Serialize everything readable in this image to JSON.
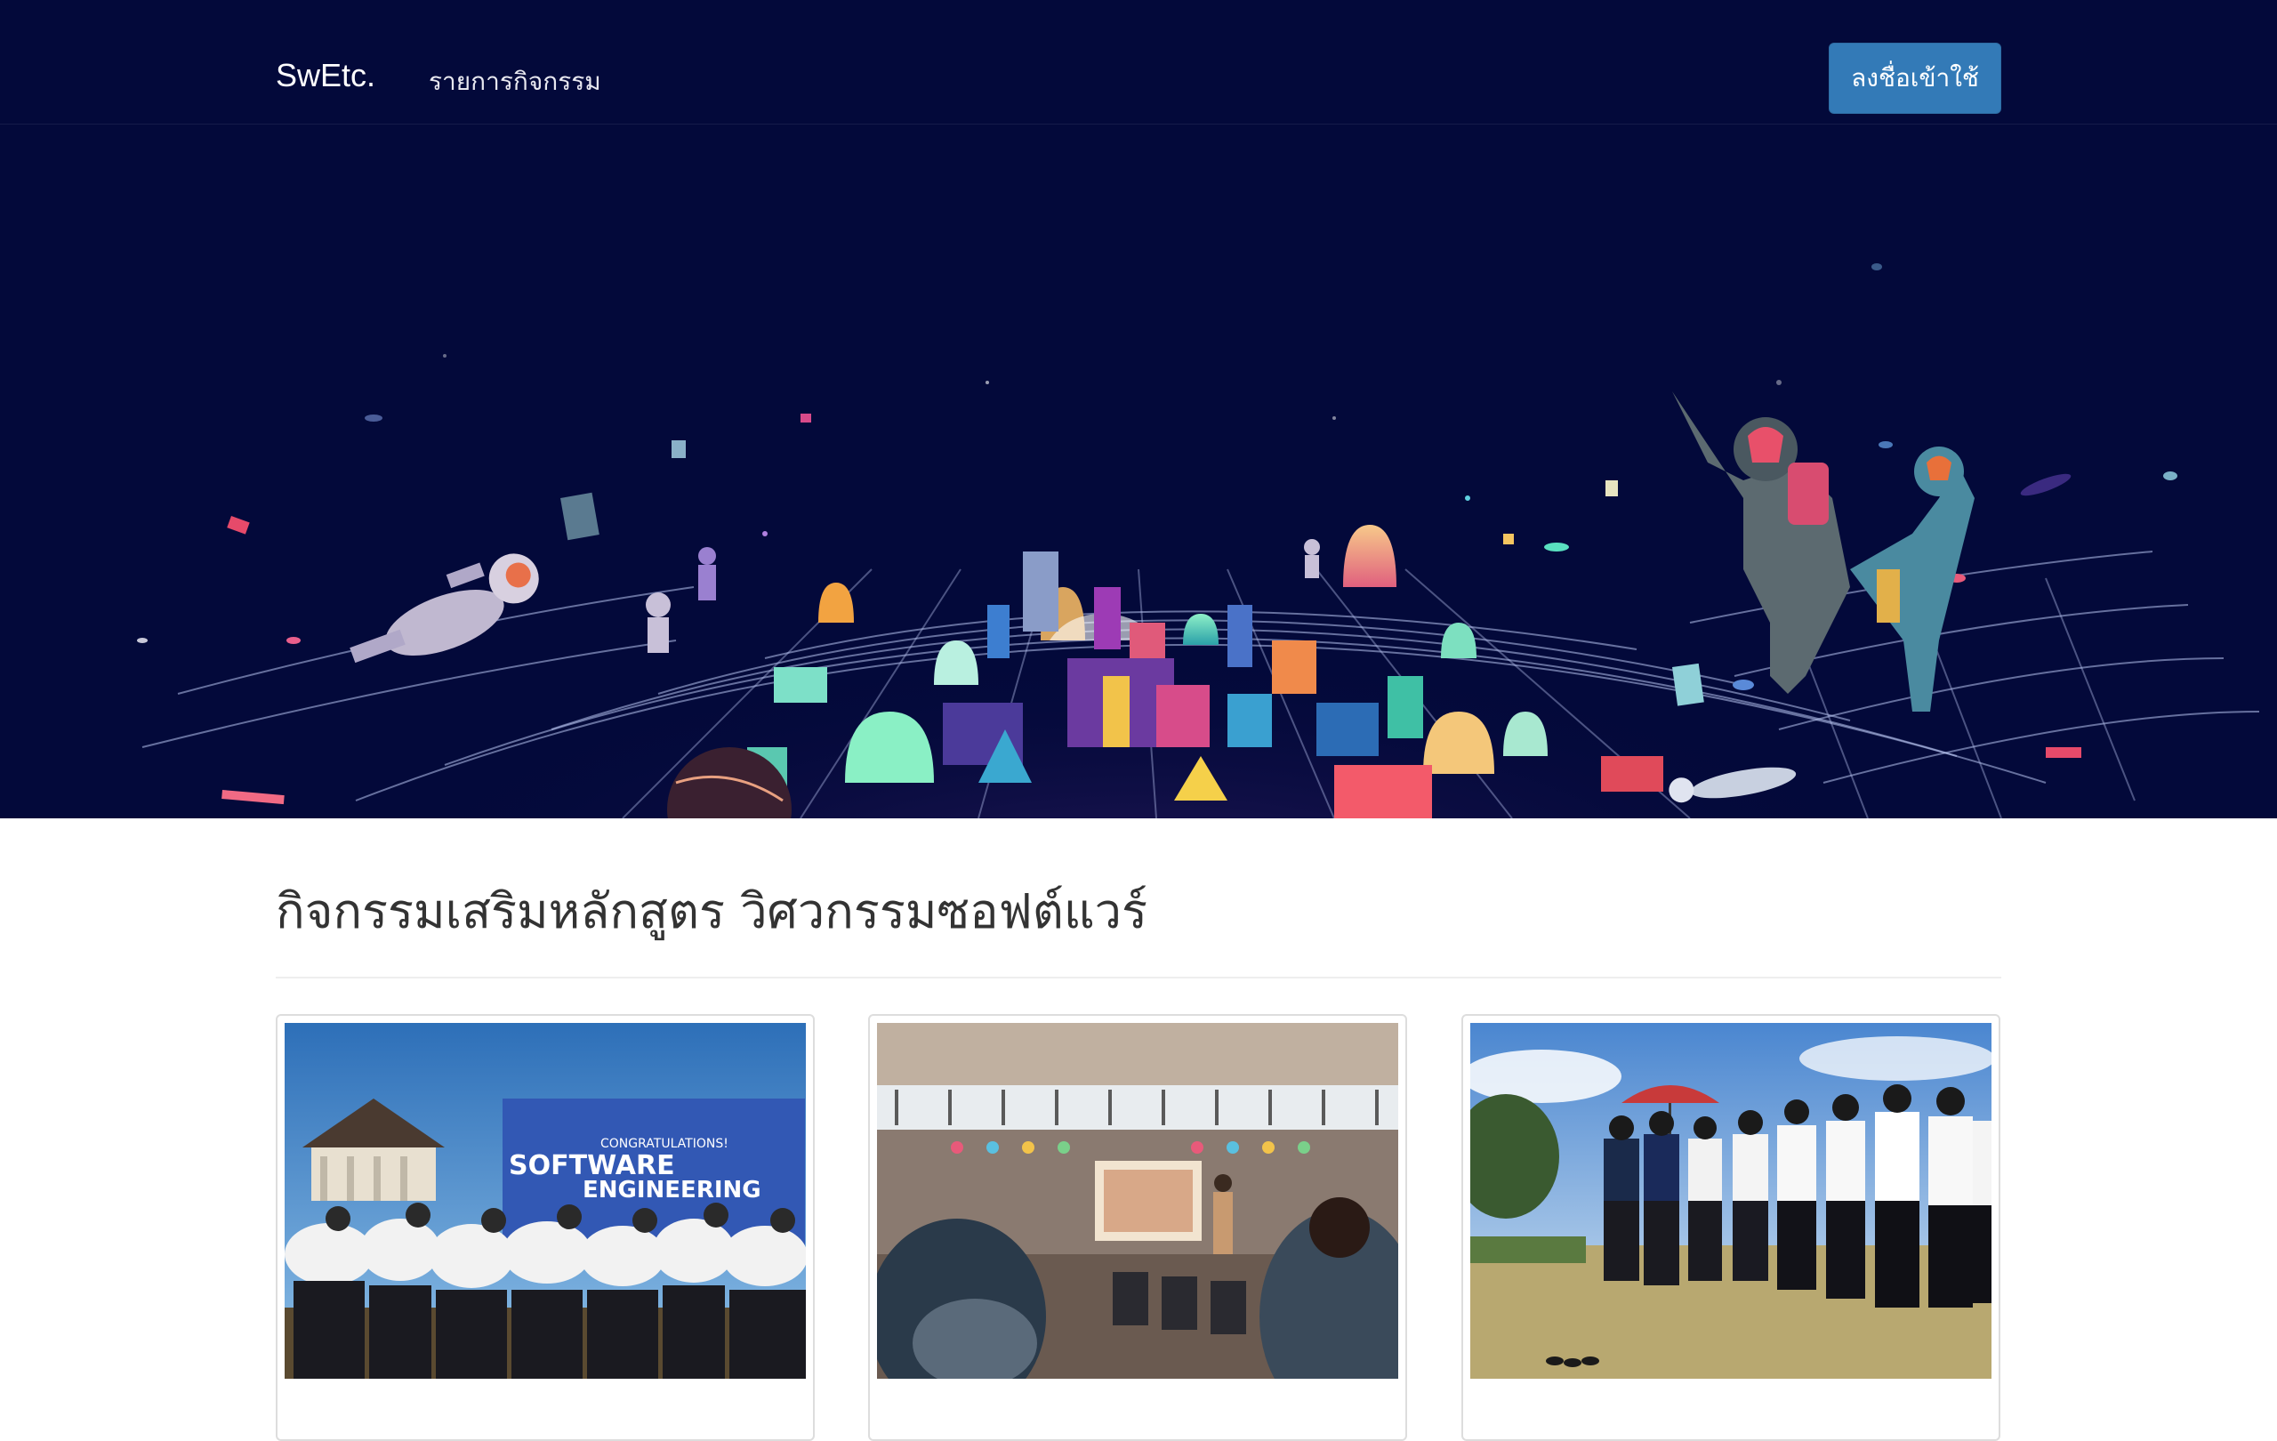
{
  "navbar": {
    "brand": "SwEtc.",
    "activities_link": "รายการกิจกรรม",
    "login_button": "ลงชื่อเข้าใช้"
  },
  "hero": {
    "background_color": "#03093a",
    "illustration": "space-astronauts-city-illustration"
  },
  "main": {
    "title": "กิจกรรมเสริมหลักสูตร วิศวกรรมซอฟต์แวร์"
  },
  "cards": [
    {
      "photo": "students-group-hug-photo",
      "banner_line1": "CONGRATULATIONS!",
      "banner_line2": "SOFTWARE",
      "banner_line3": "ENGINEERING"
    },
    {
      "photo": "presentation-room-photo"
    },
    {
      "photo": "students-outdoor-field-photo"
    }
  ],
  "colors": {
    "primary_button": "#337ab7",
    "hero_bg": "#03093a",
    "title_text": "#333333"
  }
}
